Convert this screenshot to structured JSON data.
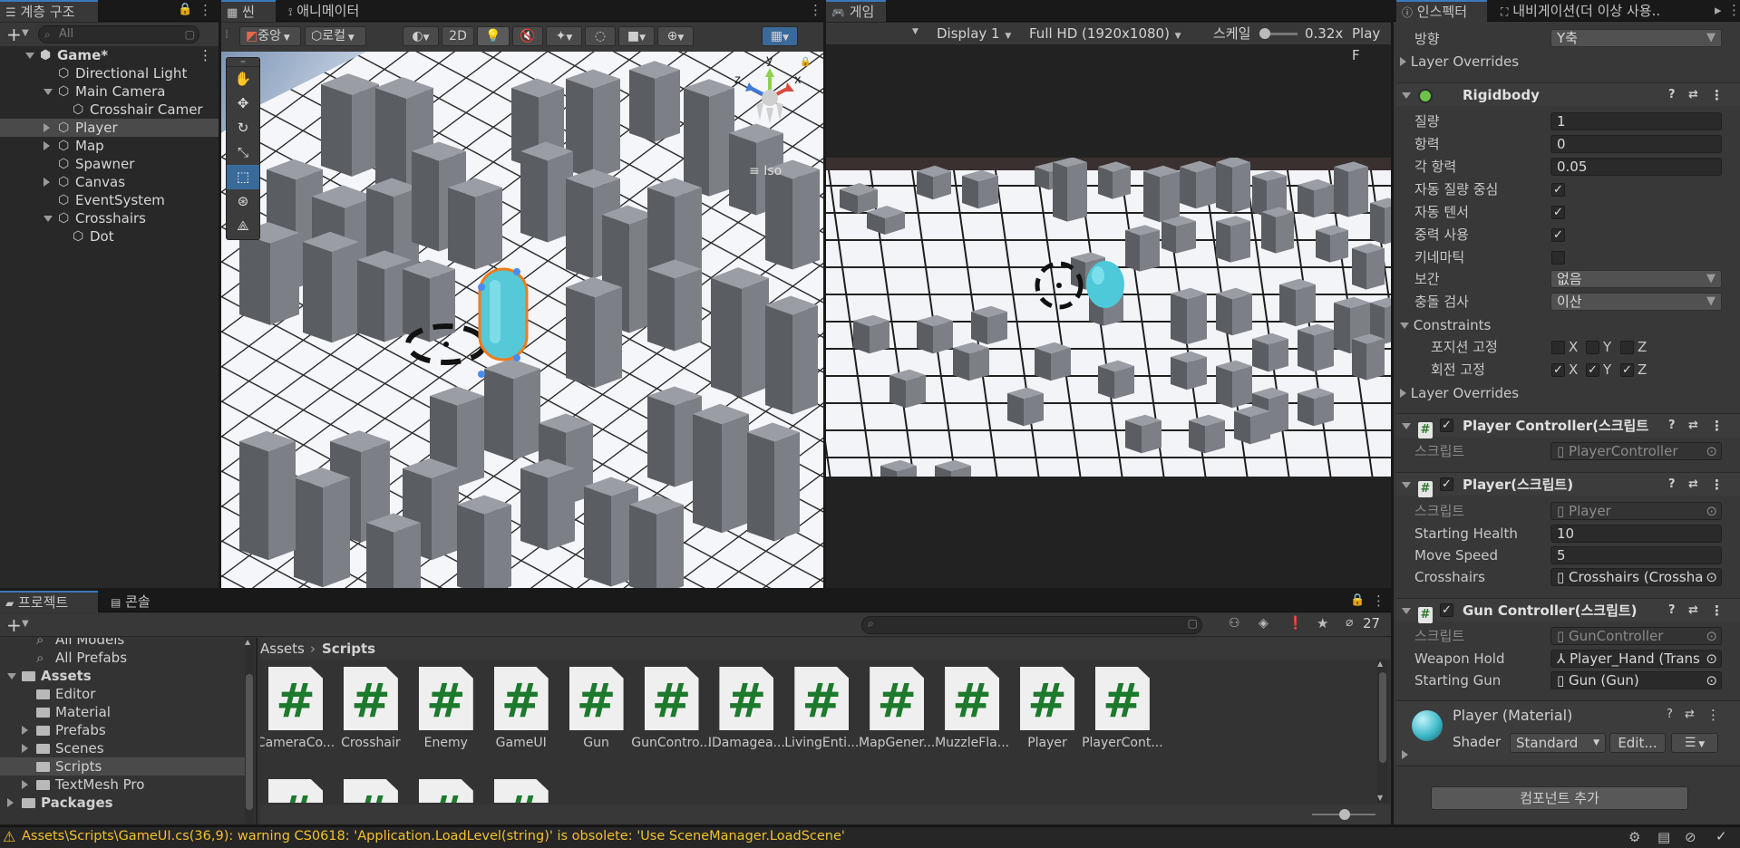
{
  "hierarchy": {
    "tab": "계층 구조",
    "search_placeholder": "All",
    "items": [
      {
        "label": "Game*",
        "depth": 0,
        "expanded": true,
        "scene": true
      },
      {
        "label": "Directional Light",
        "depth": 1
      },
      {
        "label": "Main Camera",
        "depth": 1,
        "expanded": true
      },
      {
        "label": "Crosshair Camer",
        "depth": 2
      },
      {
        "label": "Player",
        "depth": 1,
        "collapsed": true,
        "selected": true
      },
      {
        "label": "Map",
        "depth": 1,
        "collapsed": true
      },
      {
        "label": "Spawner",
        "depth": 1
      },
      {
        "label": "Canvas",
        "depth": 1,
        "collapsed": true
      },
      {
        "label": "EventSystem",
        "depth": 1
      },
      {
        "label": "Crosshairs",
        "depth": 1,
        "expanded": true
      },
      {
        "label": "Dot",
        "depth": 2
      }
    ]
  },
  "scene": {
    "tab": "씬",
    "animator_tab": "애니메이터",
    "pivot": "중앙",
    "space": "로컬",
    "mode_2d": "2D",
    "view_label": "Iso",
    "gizmo_axes": [
      "y",
      "z",
      "x"
    ]
  },
  "game": {
    "tab": "게임",
    "display": "Display 1",
    "resolution": "Full HD (1920x1080)",
    "scale_label": "스케일",
    "scale_value": "0.32x",
    "play_label": "Play F"
  },
  "inspector": {
    "tab": "인스펙터",
    "nav_tab": "내비게이션(더 이상 사용..",
    "direction_label": "방향",
    "direction_value": "Y축",
    "layer_overrides": "Layer Overrides",
    "rigidbody": {
      "title": "Rigidbody",
      "fields": [
        {
          "label": "질량",
          "value": "1"
        },
        {
          "label": "항력",
          "value": "0"
        },
        {
          "label": "각 항력",
          "value": "0.05"
        }
      ],
      "checks": [
        {
          "label": "자동 질량 중심",
          "checked": true
        },
        {
          "label": "자동 텐서",
          "checked": true
        },
        {
          "label": "중력 사용",
          "checked": true
        },
        {
          "label": "키네마틱",
          "checked": false
        }
      ],
      "interpolate_label": "보간",
      "interpolate_value": "없음",
      "collision_label": "충돌 검사",
      "collision_value": "이산",
      "constraints_label": "Constraints",
      "freeze_position_label": "포지션 고정",
      "freeze_rotation_label": "회전 고정",
      "axes": [
        "X",
        "Y",
        "Z"
      ],
      "layer_overrides": "Layer Overrides"
    },
    "player_controller": {
      "title": "Player Controller(스크립트",
      "script_label": "스크립트",
      "script_value": "PlayerController"
    },
    "player": {
      "title": "Player(스크립트)",
      "script_label": "스크립트",
      "script_value": "Player",
      "health_label": "Starting Health",
      "health_value": "10",
      "speed_label": "Move Speed",
      "speed_value": "5",
      "crosshairs_label": "Crosshairs",
      "crosshairs_value": "Crosshairs (Crossha"
    },
    "gun_controller": {
      "title": "Gun Controller(스크립트)",
      "script_label": "스크립트",
      "script_value": "GunController",
      "weapon_label": "Weapon Hold",
      "weapon_value": "Player_Hand (Trans",
      "gun_label": "Starting Gun",
      "gun_value": "Gun (Gun)"
    },
    "material": {
      "title": "Player (Material)",
      "shader_label": "Shader",
      "shader_value": "Standard",
      "edit_label": "Edit..."
    },
    "add_component": "컴포넌트 추가"
  },
  "project": {
    "tab": "프로젝트",
    "console_tab": "콘솔",
    "hidden_count": "27",
    "tree": [
      {
        "label": "All Models",
        "depth": 1,
        "search": true
      },
      {
        "label": "All Prefabs",
        "depth": 1,
        "search": true
      },
      {
        "label": "Assets",
        "depth": 0,
        "bold": true,
        "expanded": true
      },
      {
        "label": "Editor",
        "depth": 1
      },
      {
        "label": "Material",
        "depth": 1
      },
      {
        "label": "Prefabs",
        "depth": 1,
        "collapsed": true
      },
      {
        "label": "Scenes",
        "depth": 1,
        "collapsed": true
      },
      {
        "label": "Scripts",
        "depth": 1,
        "selected": true
      },
      {
        "label": "TextMesh Pro",
        "depth": 1,
        "collapsed": true
      },
      {
        "label": "Packages",
        "depth": 0,
        "bold": true,
        "collapsed": true
      }
    ],
    "breadcrumb_root": "Assets",
    "breadcrumb_current": "Scripts",
    "assets": [
      "CameraCo...",
      "Crosshair",
      "Enemy",
      "GameUI",
      "Gun",
      "GunContro...",
      "IDamagea...",
      "LivingEnti...",
      "MapGener...",
      "MuzzleFla...",
      "Player",
      "PlayerCont..."
    ],
    "asset_glyph": "#"
  },
  "status": {
    "message": "Assets\\Scripts\\GameUI.cs(36,9): warning CS0618: 'Application.LoadLevel(string)' is obsolete: 'Use SceneManager.LoadScene'"
  }
}
